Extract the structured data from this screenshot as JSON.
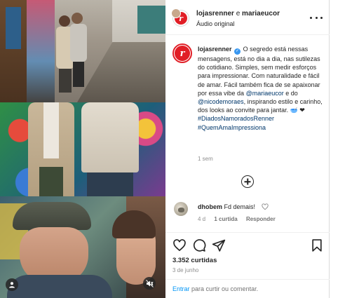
{
  "header": {
    "account1": "lojasrenner",
    "conjunction": "e",
    "account2": "mariaeucor",
    "subtitle": "Áudio original"
  },
  "brand": {
    "logo_letter": "r",
    "color": "#e11e26"
  },
  "caption": {
    "username": "lojasrenner",
    "text_part1": "O segredo está nessas mensagens, está no dia a dia, nas sutilezas do cotidiano. Simples, sem medir esforços para impressionar. Com naturalidade e fácil de amar. Fácil também fica de se apaixonar por essa vibe da",
    "mention1": "@mariaeucor",
    "text_part2": "e do",
    "mention2": "@nicodemoraes",
    "text_part3": ", inspirando estilo e carinho, dos looks ao convite para jantar. 🥣 ❤",
    "hashtag1": "#DiadosNamoradosRenner",
    "hashtag2": "#QuemAmaImpressiona",
    "time": "1 sem"
  },
  "comment": {
    "username": "dhobem",
    "text": "Fd demais!",
    "age": "4 d",
    "likes": "1 curtida",
    "reply": "Responder"
  },
  "stats": {
    "likes": "3.352 curtidas",
    "date": "3 de junho"
  },
  "login": {
    "link": "Entrar",
    "rest": "para curtir ou comentar."
  },
  "icons": {
    "more": "more-options-icon",
    "add_comment": "add-comment-icon",
    "like": "heart-icon",
    "comment": "comment-icon",
    "share": "share-icon",
    "save": "bookmark-icon",
    "user": "user-tag-icon",
    "mute": "muted-audio-icon"
  }
}
